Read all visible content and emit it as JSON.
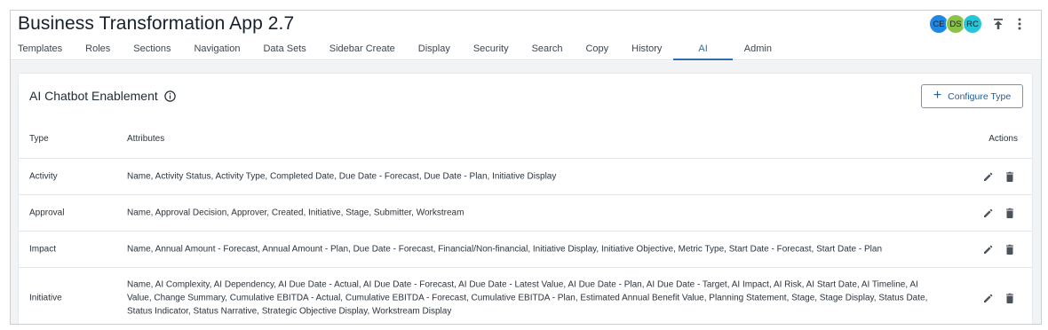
{
  "app": {
    "title": "Business Transformation App 2.7"
  },
  "users": [
    {
      "initials": "CE",
      "color": "#1e88e5"
    },
    {
      "initials": "DS",
      "color": "#8bc34a"
    },
    {
      "initials": "RC",
      "color": "#26c6da"
    }
  ],
  "tabs": [
    {
      "label": "Templates",
      "active": false
    },
    {
      "label": "Roles",
      "active": false
    },
    {
      "label": "Sections",
      "active": false
    },
    {
      "label": "Navigation",
      "active": false
    },
    {
      "label": "Data Sets",
      "active": false
    },
    {
      "label": "Sidebar Create",
      "active": false
    },
    {
      "label": "Display",
      "active": false
    },
    {
      "label": "Security",
      "active": false
    },
    {
      "label": "Search",
      "active": false
    },
    {
      "label": "Copy",
      "active": false
    },
    {
      "label": "History",
      "active": false
    },
    {
      "label": "AI",
      "active": true
    },
    {
      "label": "Admin",
      "active": false
    }
  ],
  "card": {
    "title": "AI Chatbot Enablement",
    "configure_label": "Configure Type"
  },
  "table": {
    "headers": {
      "type": "Type",
      "attributes": "Attributes",
      "actions": "Actions"
    },
    "rows": [
      {
        "type": "Activity",
        "attributes": "Name, Activity Status, Activity Type, Completed Date, Due Date - Forecast, Due Date - Plan, Initiative Display"
      },
      {
        "type": "Approval",
        "attributes": "Name, Approval Decision, Approver, Created, Initiative, Stage, Submitter, Workstream"
      },
      {
        "type": "Impact",
        "attributes": "Name, Annual Amount - Forecast, Annual Amount - Plan, Due Date - Forecast, Financial/Non-financial, Initiative Display, Initiative Objective, Metric Type, Start Date - Forecast, Start Date - Plan"
      },
      {
        "type": "Initiative",
        "attributes": "Name, AI Complexity, AI Dependency, AI Due Date - Actual, AI Due Date - Forecast, AI Due Date - Latest Value, AI Due Date - Plan, AI Due Date - Target, AI Impact, AI Risk, AI Start Date, AI Timeline, AI Value, Change Summary, Cumulative EBITDA - Actual, Cumulative EBITDA - Forecast, Cumulative EBITDA - Plan, Estimated Annual Benefit Value, Planning Statement, Stage, Stage Display, Status Date, Status Indicator, Status Narrative, Strategic Objective Display, Workstream Display"
      }
    ]
  },
  "icons": {
    "upload": "upload-icon",
    "more": "more-vertical-icon",
    "info": "info-icon",
    "edit": "pencil-icon",
    "delete": "trash-icon"
  },
  "colors": {
    "accent": "#2e6dae",
    "button_border": "#5b9bd1"
  }
}
